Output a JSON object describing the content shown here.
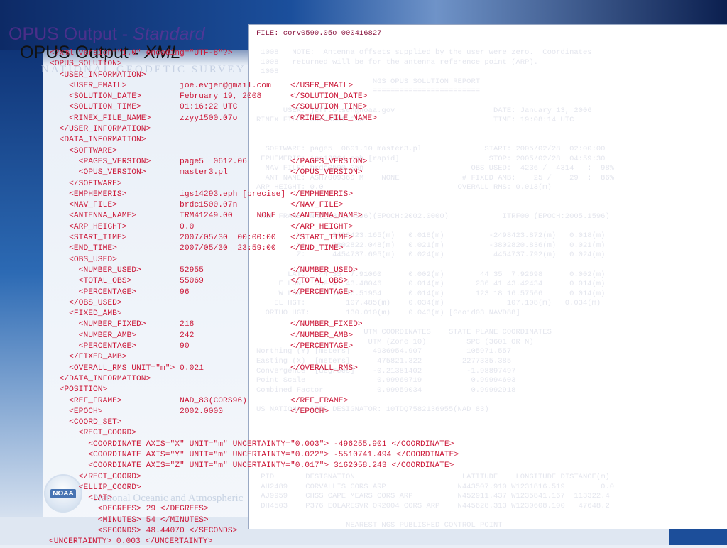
{
  "slide": {
    "title_main": "OPUS Output - ",
    "title_standard": "Standard",
    "title2_main": "OPUS Output - ",
    "title2_xml": "XML",
    "watermark_ngs": "NATIONAL GEODETIC SURVEY",
    "watermark_noaa": "National Oceanic and Atmospheric",
    "noaa_logo_text": "NOAA"
  },
  "report": {
    "header": "FILE: corv0590.05o 000416827",
    "lines": [
      " 1008   NOTE:  Antenna offsets supplied by the user were zero.  Coordinates",
      " 1008   returned will be for the antenna reference point (ARP).",
      " 1008",
      "                          NGS OPUS SOLUTION REPORT",
      "                          ========================",
      "",
      "      USER: jeff.olsen@noaa.gov                      DATE: January 13, 2006",
      "RINEX FILE: corv059f.05o                             TIME: 19:08:14 UTC",
      "",
      "",
      "  SOFTWARE: page5  0601.10 master3.pl              START: 2005/02/28  02:00:00",
      " EPHEMERIS: igs13264.eph [rapid]                    STOP: 2005/02/28  04:59:30",
      "  NAV FILE: brdc0590.05n                        OBS USED:  4236 /  4314   :  98%",
      "  ANT NAME: ASH700936D_M    NONE              # FIXED AMB:    25 /    29  :  86%",
      "ARP HEIGHT: 0.0                              OVERALL RMS: 0.013(m)",
      "",
      "",
      " REF FRAME: NAD_83(CORS96)(EPOCH:2002.0000)            ITRF00 (EPOCH:2005.1596)",
      "",
      "         X:     -2498423.165(m)   0.018(m)          -2498423.872(m)   0.018(m)",
      "         Y:     -3802822.048(m)   0.021(m)          -3802820.836(m)   0.021(m)",
      "         Z:      4454737.695(m)   0.024(m)           4454737.792(m)   0.024(m)",
      "",
      "       LAT:   44 35  7.91060      0.002(m)        44 35  7.92698      0.002(m)",
      "     E LON:  236 41 43.48046      0.014(m)       236 41 43.42434      0.014(m)",
      "     W LON:  123 18 16.51954      0.014(m)       123 18 16.57566      0.014(m)",
      "    EL HGT:         107.485(m)    0.034(m)              107.108(m)   0.034(m)",
      "  ORTHO HGT:        130.010(m)    0.043(m) [Geoid03 NAVD88]",
      "",
      "                        UTM COORDINATES    STATE PLANE COORDINATES",
      "                         UTM (Zone 10)         SPC (3601 OR N)",
      "Northing (Y) [meters]     4936954.907          105971.557",
      "Easting (X)  [meters]      475821.322         2277335.385",
      "Convergence  [degrees]    -0.21381402          -1.98897497",
      "Point Scale                0.99960719           0.99994603",
      "Combined Factor            0.99959034           0.99992918",
      "",
      "US NATIONAL GRID DESIGNATOR: 10TDQ7582136955(NAD 83)",
      "",
      "",
      "",
      "",
      "",
      "",
      " PID       DESIGNATION                        LATITUDE    LONGITUDE DISTANCE(m)",
      " AH2489    CORVALLIS CORS ARP                N443507.910 W1231816.519        0.0",
      " AJ9959    CHSS CAPE MEARS CORS ARP          N452911.437 W1235841.167  113322.4",
      " DH4503    P376 EOLARESVR_OR2004 CORS ARP    N445628.313 W1230608.100   47648.2",
      "",
      "                    NEAREST NGS PUBLISHED CONTROL POINT",
      " AH2486      CORVALLIS CORS ARP            N443507.910 W1231816.519        0.0"
    ]
  },
  "xml_lines": [
    "<?xml version=\"1.0\" encoding=\"UTF-8\"?>",
    "<OPUS_SOLUTION>",
    "  <USER_INFORMATION>",
    "    <USER_EMAIL>           joe.evjen@gmail.com    </USER_EMAIL>",
    "    <SOLUTION_DATE>        February 19, 2008      </SOLUTION_DATE>",
    "    <SOLUTION_TIME>        01:16:22 UTC           </SOLUTION_TIME>",
    "    <RINEX_FILE_NAME>      zzyy1500.07o           </RINEX_FILE_NAME>",
    "  </USER_INFORMATION>",
    "  <DATA_INFORMATION>",
    "    <SOFTWARE>",
    "      <PAGES_VERSION>      page5  0612.06         </PAGES_VERSION>",
    "      <OPUS_VERSION>       master3.pl             </OPUS_VERSION>",
    "    </SOFTWARE>",
    "    <EMPHEMERIS>           igs14293.eph [precise] </EMPHEMERIS>",
    "    <NAV_FILE>             brdc1500.07n           </NAV_FILE>",
    "    <ANTENNA_NAME>         TRM41249.00     NONE   </ANTENNA_NAME>",
    "    <ARP_HEIGHT>           0.0                    </ARP_HEIGHT>",
    "    <START_TIME>           2007/05/30  00:00:00   </START_TIME>",
    "    <END_TIME>             2007/05/30  23:59:00   </END_TIME>",
    "    <OBS_USED>",
    "      <NUMBER_USED>        52955                  </NUMBER_USED>",
    "      <TOTAL_OBS>          55069                  </TOTAL_OBS>",
    "      <PERCENTAGE>         96                     </PERCENTAGE>",
    "    </OBS_USED>",
    "    <FIXED_AMB>",
    "      <NUMBER_FIXED>       218                    </NUMBER_FIXED>",
    "      <NUMBER_AMB>         242                    </NUMBER_AMB>",
    "      <PERCENTAGE>         90                     </PERCENTAGE>",
    "    </FIXED_AMB>",
    "    <OVERALL_RMS UNIT=\"m\"> 0.021                  </OVERALL_RMS>",
    "  </DATA_INFORMATION>",
    "  <POSITION>",
    "    <REF_FRAME>            NAD_83(CORS96)         </REF_FRAME>",
    "    <EPOCH>                2002.0000              </EPOCH>",
    "    <COORD_SET>",
    "      <RECT_COORD>",
    "        <COORDINATE AXIS=\"X\" UNIT=\"m\" UNCERTAINTY=\"0.003\"> -496255.901 </COORDINATE>",
    "        <COORDINATE AXIS=\"Y\" UNIT=\"m\" UNCERTAINTY=\"0.022\"> -5510741.494 </COORDINATE>",
    "        <COORDINATE AXIS=\"Z\" UNIT=\"m\" UNCERTAINTY=\"0.017\"> 3162058.243 </COORDINATE>",
    "      </RECT_COORD>",
    "      <ELLIP_COORD>",
    "        <LAT>",
    "          <DEGREES> 29 </DEGREES>",
    "          <MINUTES> 54 </MINUTES>",
    "          <SECONDS> 48.44070 </SECONDS>",
    "<UNCERTAINTY> 0.003 </UNCERTAINTY>"
  ],
  "colors": {
    "xml_text": "#cc1a3a",
    "title_faded": "#7b2fa1",
    "report_header": "#8a1640"
  }
}
